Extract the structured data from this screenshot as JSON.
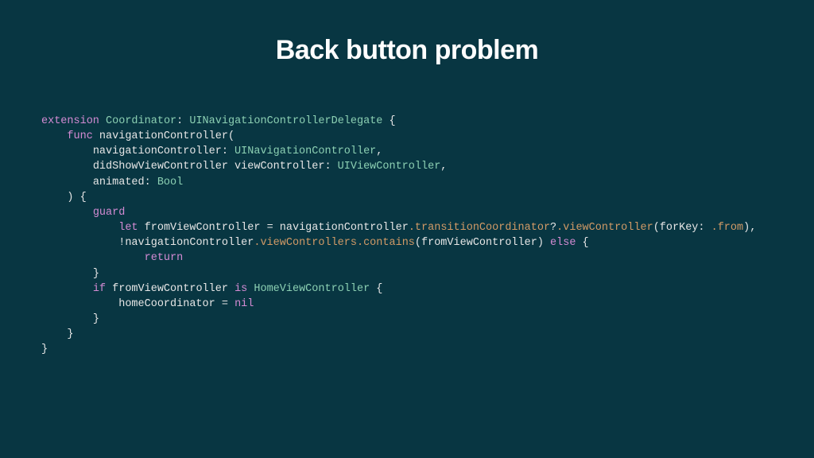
{
  "title": "Back button problem",
  "code": {
    "l1": {
      "kw1": "extension",
      "sp1": " ",
      "t1": "Coordinator",
      "p1": ": ",
      "t2": "UINavigationControllerDelegate",
      "p2": " {"
    },
    "l2": {
      "ind": "    ",
      "kw1": "func",
      "sp1": " ",
      "id1": "navigationController",
      "p1": "("
    },
    "l3": {
      "ind": "        ",
      "id1": "navigationController",
      "p1": ": ",
      "t1": "UINavigationController",
      "p2": ","
    },
    "l4": {
      "ind": "        ",
      "id1": "didShowViewController viewController",
      "p1": ": ",
      "t1": "UIViewController",
      "p2": ","
    },
    "l5": {
      "ind": "        ",
      "id1": "animated",
      "p1": ": ",
      "t1": "Bool"
    },
    "l6": {
      "ind": "    ",
      "p1": ") {"
    },
    "l7": {
      "ind": "        ",
      "kw1": "guard"
    },
    "l8": {
      "ind": "            ",
      "kw1": "let",
      "sp1": " ",
      "id1": "fromViewController",
      "p1": " = ",
      "id2": "navigationController",
      "c1": ".transitionCoordinator",
      "p2": "?",
      "c2": ".viewController",
      "p3": "(forKey: ",
      "c3": ".from",
      "p4": "),"
    },
    "l9": {
      "ind": "            ",
      "p1": "!",
      "id1": "navigationController",
      "c1": ".viewControllers",
      "c2": ".contains",
      "p2": "(fromViewController) ",
      "kw1": "else",
      "p3": " {"
    },
    "l10": {
      "ind": "                ",
      "kw1": "return"
    },
    "l11": {
      "ind": "        ",
      "p1": "}"
    },
    "l12": {
      "ind": "        ",
      "kw1": "if",
      "sp1": " ",
      "id1": "fromViewController",
      "sp2": " ",
      "kw2": "is",
      "sp3": " ",
      "t1": "HomeViewController",
      "p1": " {"
    },
    "l13": {
      "ind": "            ",
      "id1": "homeCoordinator",
      "p1": " = ",
      "kw1": "nil"
    },
    "l14": {
      "ind": "        ",
      "p1": "}"
    },
    "l15": {
      "ind": "    ",
      "p1": "}"
    },
    "l16": {
      "p1": "}"
    }
  }
}
